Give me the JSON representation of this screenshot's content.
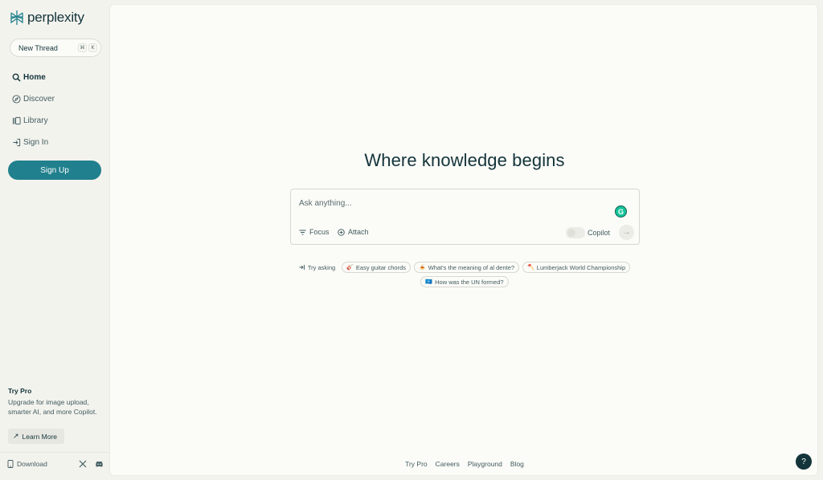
{
  "brand": {
    "name": "perplexity",
    "logo_icon": "perplexity-logo-icon",
    "accent": "#20808d"
  },
  "sidebar": {
    "new_thread": {
      "label": "New Thread",
      "kbd_cmd": "⌘",
      "kbd_key": "K"
    },
    "items": [
      {
        "label": "Home",
        "icon": "search-icon",
        "active": true
      },
      {
        "label": "Discover",
        "icon": "compass-icon"
      },
      {
        "label": "Library",
        "icon": "library-icon"
      },
      {
        "label": "Sign In",
        "icon": "sign-in-icon"
      }
    ],
    "signup_label": "Sign Up",
    "try_pro": {
      "title": "Try Pro",
      "description": "Upgrade for image upload, smarter AI, and more Copilot.",
      "learn_more": "Learn More"
    },
    "download_label": "Download"
  },
  "main": {
    "headline": "Where knowledge begins",
    "search": {
      "placeholder": "Ask anything...",
      "focus_label": "Focus",
      "attach_label": "Attach",
      "copilot_label": "Copilot"
    },
    "try_asking_label": "Try asking",
    "suggestions_row1": [
      {
        "emoji": "🎸",
        "label": "Easy guitar chords"
      },
      {
        "emoji": "🍝",
        "label": "What's the meaning of al dente?"
      },
      {
        "emoji": "🪓",
        "label": "Lumberjack World Championship"
      }
    ],
    "suggestions_row2": [
      {
        "emoji": "🇺🇳",
        "label": "How was the UN formed?"
      }
    ],
    "footer_links": [
      "Try Pro",
      "Careers",
      "Playground",
      "Blog"
    ],
    "help_label": "?"
  }
}
